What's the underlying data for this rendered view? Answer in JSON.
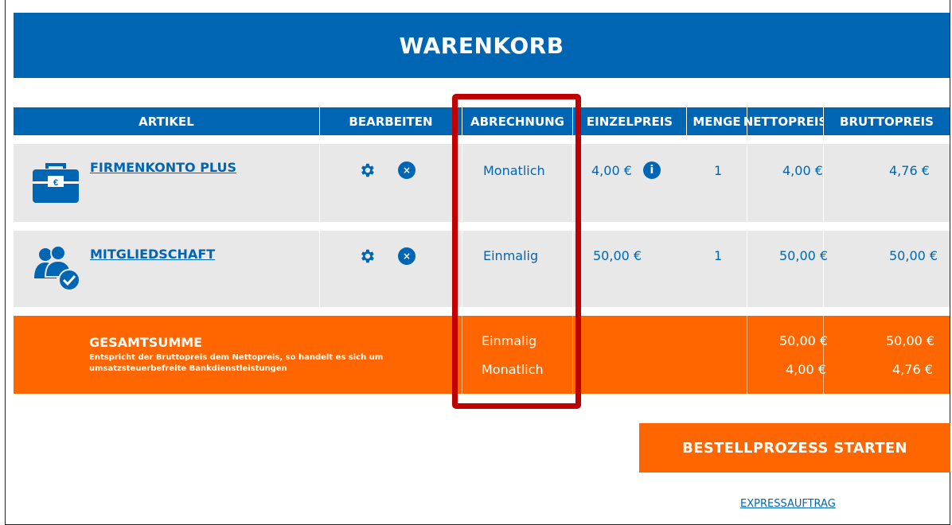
{
  "title": "WARENKORB",
  "columns": [
    "ARTIKEL",
    "BEARBEITEN",
    "ABRECHNUNG",
    "EINZELPREIS",
    "MENGE",
    "NETTOPREIS",
    "BRUTTOPREIS"
  ],
  "items": [
    {
      "name": "FIRMENKONTO PLUS",
      "icon": "briefcase-euro-icon",
      "billing": "Monatlich",
      "unit_price": "4,00 €",
      "has_info": true,
      "info_symbol": "i",
      "quantity": "1",
      "net": "4,00 €",
      "gross": "4,76 €"
    },
    {
      "name": "MITGLIEDSCHAFT",
      "icon": "members-check-icon",
      "billing": "Einmalig",
      "unit_price": "50,00 €",
      "has_info": false,
      "quantity": "1",
      "net": "50,00 €",
      "gross": "50,00 €"
    }
  ],
  "edit_icons": {
    "settings": "gear-icon",
    "remove": "close-icon",
    "remove_symbol": "×"
  },
  "total": {
    "label": "GESAMTSUMME",
    "note": "Entspricht der Bruttopreis dem Nettopreis, so handelt es sich um umsatzsteuerbefreite Bankdienstleistungen",
    "rows": [
      {
        "billing": "Einmalig",
        "net": "50,00 €",
        "gross": "50,00 €"
      },
      {
        "billing": "Monatlich",
        "net": "4,00 €",
        "gross": "4,76 €"
      }
    ]
  },
  "cta_label": "BESTELLPROZESS STARTEN",
  "express_label": "EXPRESSAUFTRAG",
  "colors": {
    "primary": "#0066b3",
    "accent": "#ff6600",
    "highlight": "#c00000",
    "row_bg": "#e8e8e8"
  }
}
